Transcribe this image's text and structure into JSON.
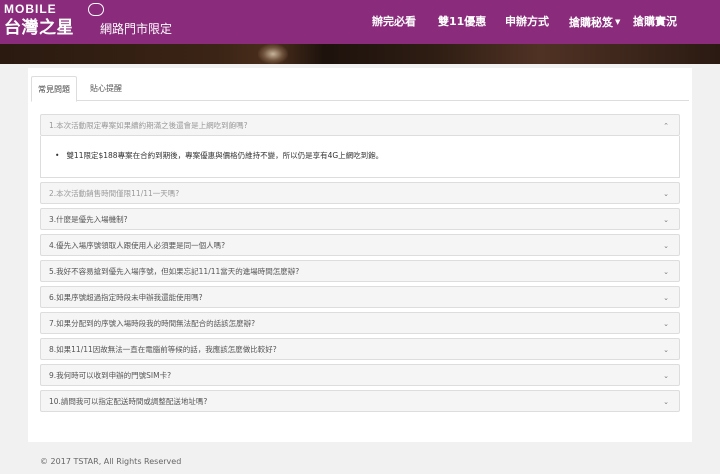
{
  "brand": {
    "top": "MOBILE",
    "name_cn": "台灣之星",
    "sub": "網路門市限定"
  },
  "nav": [
    {
      "label": "辦完必看"
    },
    {
      "label": "雙11優惠"
    },
    {
      "label": "申辦方式"
    },
    {
      "label": "搶購秘笈"
    },
    {
      "label": "搶購實況"
    }
  ],
  "tabs": [
    {
      "label": "常見問題",
      "active": true
    },
    {
      "label": "貼心提醒",
      "active": false
    }
  ],
  "faq": [
    {
      "q": "1.本次活動限定專案如果續約期滿之後還會是上網吃到飽嗎?",
      "open": true,
      "a": "雙11限定$188專案在合約到期後，專案優惠與價格仍維持不變，所以仍是享有4G上網吃到飽。"
    },
    {
      "q": "2.本次活動銷售時間僅限11/11一天嗎?",
      "dim": true
    },
    {
      "q": "3.什麼是優先入場機制?"
    },
    {
      "q": "4.優先入場序號領取人跟使用人必須要是同一個人嗎?"
    },
    {
      "q": "5.我好不容易搶到優先入場序號，但如果忘記11/11當天的進場時間怎麼辦?"
    },
    {
      "q": "6.如果序號超過指定時段未申辦我還能使用嗎?"
    },
    {
      "q": "7.如果分配到的序號入場時段我的時間無法配合的話該怎麼辦?"
    },
    {
      "q": "8.如果11/11因故無法一直在電腦前等候的話，我應該怎麼做比較好?"
    },
    {
      "q": "9.我何時可以收到申辦的門號SIM卡?"
    },
    {
      "q": "10.請問我可以指定配送時間或調整配送地址嗎?"
    }
  ],
  "footer": "© 2017 TSTAR, All Rights Reserved"
}
